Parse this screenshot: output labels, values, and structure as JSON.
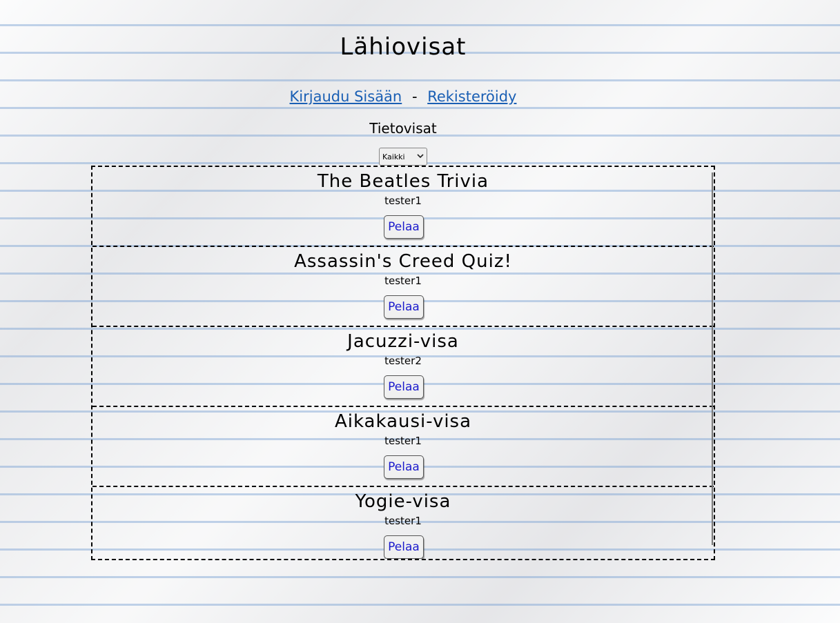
{
  "header": {
    "title": "Lähiovisat"
  },
  "auth": {
    "login_label": "Kirjaudu Sisään",
    "separator": "-",
    "register_label": "Rekisteröidy"
  },
  "section": {
    "title": "Tietovisat"
  },
  "filter": {
    "selected": "Kaikki"
  },
  "quizzes": [
    {
      "name": "The Beatles Trivia",
      "author": "tester1",
      "play_label": "Pelaa"
    },
    {
      "name": "Assassin's Creed Quiz!",
      "author": "tester1",
      "play_label": "Pelaa"
    },
    {
      "name": "Jacuzzi-visa",
      "author": "tester2",
      "play_label": "Pelaa"
    },
    {
      "name": "Aikakausi-visa",
      "author": "tester1",
      "play_label": "Pelaa"
    },
    {
      "name": "Yogie-visa",
      "author": "tester1",
      "play_label": "Pelaa"
    }
  ],
  "icons": {
    "filter_chevron": "chevron-down-icon"
  }
}
